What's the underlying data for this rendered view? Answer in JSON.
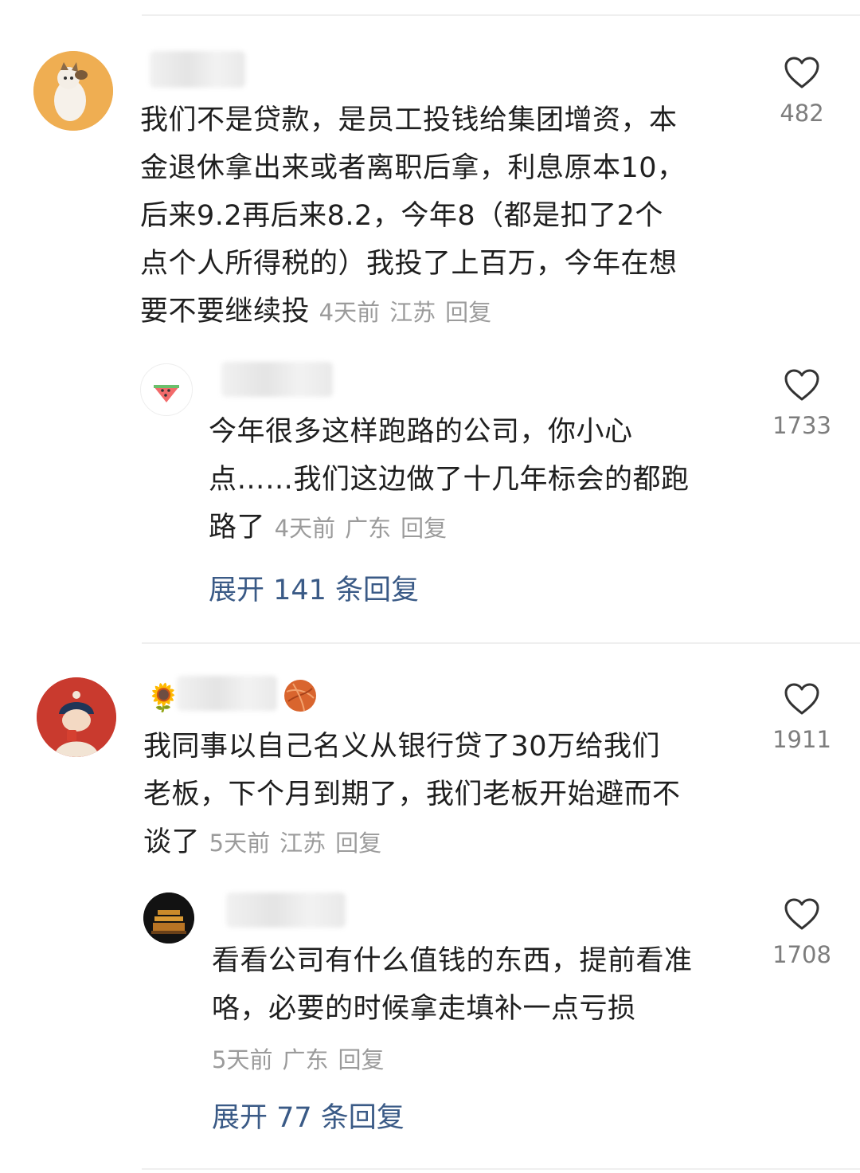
{
  "comments": [
    {
      "username": "",
      "text_lines": [
        "我们不是贷款，是员工投钱给集团增资，本",
        "金退休拿出来或者离职后拿，利息原本10，",
        "后来9.2再后来8.2，今年8（都是扣了2个",
        "点个人所得税的）我投了上百万，今年在想",
        "要不要继续投"
      ],
      "time": "4天前",
      "location": "江苏",
      "reply_label": "回复",
      "likes": "482",
      "reply": {
        "username": "",
        "text_lines": [
          "今年很多这样跑路的公司，你小心",
          "点……我们这边做了十几年标会的都跑",
          "路了"
        ],
        "time": "4天前",
        "location": "广东",
        "reply_label": "回复",
        "likes": "1733"
      },
      "expand_label": "展开 141 条回复"
    },
    {
      "username": "",
      "badge_left": "🌻",
      "text_lines": [
        "我同事以自己名义从银行贷了30万给我们",
        "老板，下个月到期了，我们老板开始避而不",
        "谈了"
      ],
      "time": "5天前",
      "location": "江苏",
      "reply_label": "回复",
      "likes": "1911",
      "reply": {
        "username": "",
        "text_lines": [
          "看看公司有什么值钱的东西，提前看准",
          "咯，必要的时候拿走填补一点亏损"
        ],
        "time": "5天前",
        "location": "广东",
        "reply_label": "回复",
        "likes": "1708"
      },
      "expand_label": "展开 77 条回复"
    }
  ],
  "icons": {
    "like": "heart-outline-icon"
  }
}
